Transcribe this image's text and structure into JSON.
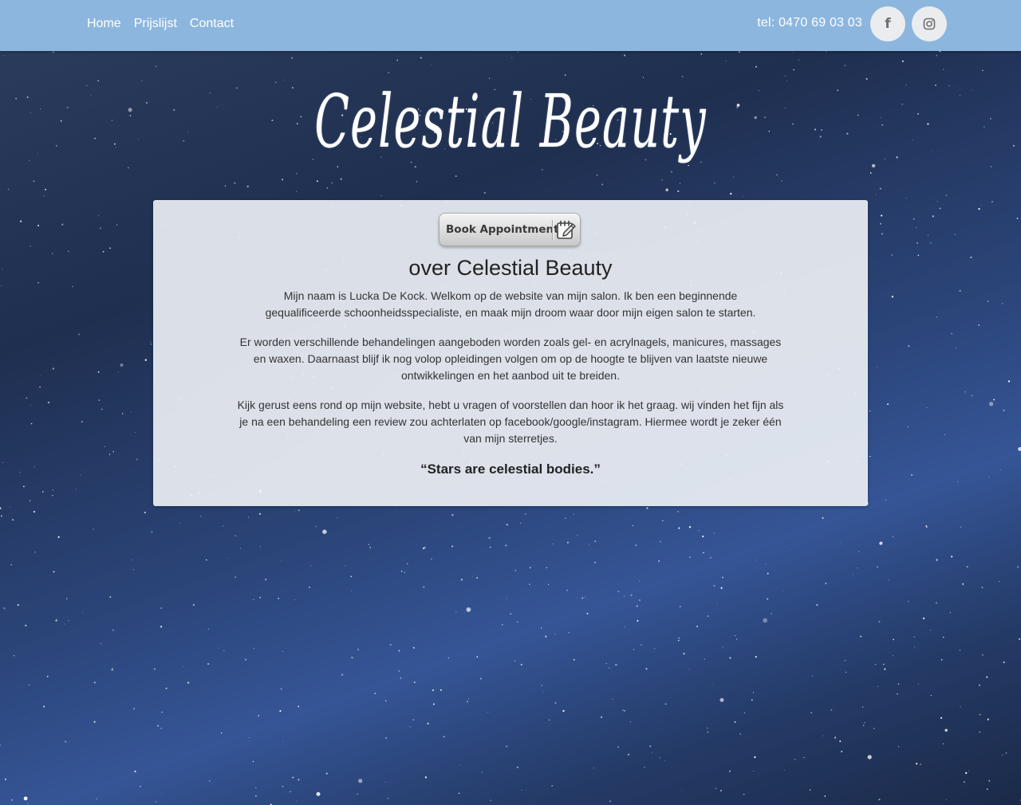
{
  "nav": {
    "items": [
      {
        "label": "Home"
      },
      {
        "label": "Prijslijst"
      },
      {
        "label": "Contact"
      }
    ],
    "phone": "tel: 0470 69 03 03",
    "social": [
      {
        "icon": "facebook-icon",
        "glyph": "f"
      },
      {
        "icon": "instagram-icon"
      }
    ]
  },
  "hero": {
    "logo_text": "Celestial Beauty"
  },
  "card": {
    "book_button_label": "Book Appointment",
    "title": "over Celestial Beauty",
    "paragraphs": [
      "Mijn naam is Lucka De Kock. Welkom op de website van mijn salon. Ik ben een beginnende gequalificeerde schoonheidsspecialiste, en maak mijn droom waar door mijn eigen salon te starten.",
      "Er worden verschillende behandelingen aangeboden worden zoals gel- en acrylnagels, manicures, massages en waxen. Daarnaast blijf ik nog volop opleidingen volgen om op de hoogte te blijven van laatste nieuwe ontwikkelingen en het aanbod uit te breiden.",
      "Kijk gerust eens rond op mijn website, hebt u vragen of voorstellen dan hoor ik het graag. wij vinden het fijn als je na een behandeling een review zou achterlaten op facebook/google/instagram. Hiermee wordt je zeker één van mijn sterretjes."
    ],
    "quote": "“Stars are celestial bodies.”"
  },
  "colors": {
    "navbar": "#8db6de",
    "card_background": "#eceff4",
    "social_button": "#ebecef"
  }
}
